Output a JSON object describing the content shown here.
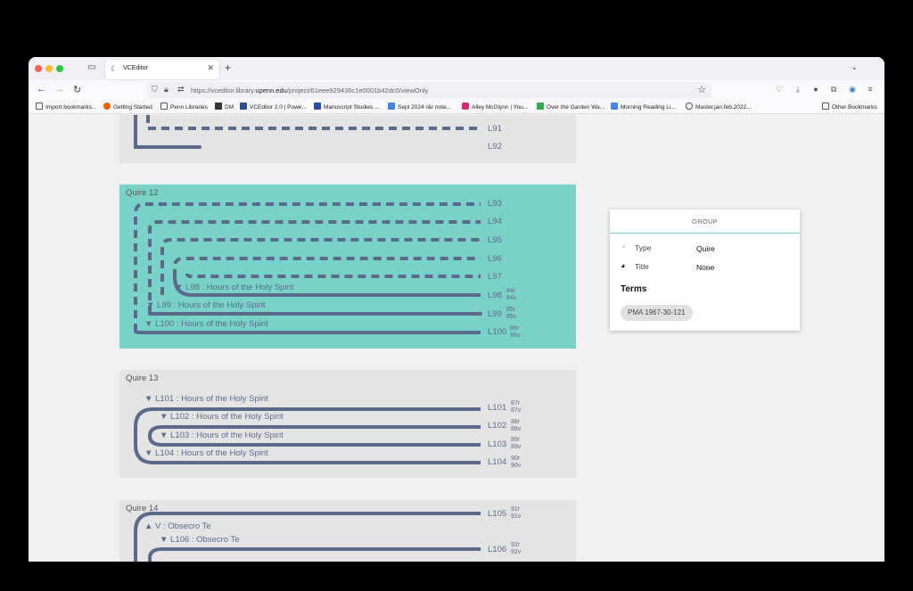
{
  "browser": {
    "tab_title": "VCEditor",
    "url_prefix": "https://vceditor.library.",
    "url_domain": "upenn.edu",
    "url_path": "/project/61eee929435c1e0001b42dc0/viewOnly"
  },
  "bookmarks": [
    "Import bookmarks...",
    "Getting Started",
    "Penn Libraries",
    "DM",
    "VCEditor 2.0 | Powe...",
    "Manuscript Studies ...",
    "Sept 2024 r&r note...",
    "Alley McGlynn | You...",
    "Over the Garden Wa...",
    "Morning Reading Li...",
    "Master.jan.feb.2022...",
    "Other Bookmarks"
  ],
  "quires": {
    "q11": {
      "leaves": [
        {
          "label": "L91"
        },
        {
          "label": "L92"
        }
      ]
    },
    "q12": {
      "title": "Quire 12",
      "color": "#78d2c8",
      "leaves": [
        {
          "label": "L93"
        },
        {
          "label": "L94"
        },
        {
          "label": "L95"
        },
        {
          "label": "L96"
        },
        {
          "label": "L97"
        },
        {
          "label": "L98",
          "folio_r": "84r",
          "folio_v": "84v",
          "term": "▼ L98 : Hours of the Holy Spirit"
        },
        {
          "label": "L99",
          "folio_r": "85r",
          "folio_v": "85v",
          "term": "▼ L99 : Hours of the Holy Spirit"
        },
        {
          "label": "L100",
          "folio_r": "86r",
          "folio_v": "86v",
          "term": "▼ L100 : Hours of the Holy Spirit"
        }
      ]
    },
    "q13": {
      "title": "Quire 13",
      "leaves": [
        {
          "label": "L101",
          "folio_r": "87r",
          "folio_v": "87v",
          "term": "▼ L101 : Hours of the Holy Spirit"
        },
        {
          "label": "L102",
          "folio_r": "88r",
          "folio_v": "88v",
          "term": "▼ L102 : Hours of the Holy Spirit"
        },
        {
          "label": "L103",
          "folio_r": "89r",
          "folio_v": "89v",
          "term": "▼ L103 : Hours of the Holy Spirit"
        },
        {
          "label": "L104",
          "folio_r": "90r",
          "folio_v": "90v",
          "term": "▼ L104 : Hours of the Holy Spirit"
        }
      ]
    },
    "q14": {
      "title": "Quire 14",
      "leaves": [
        {
          "label": "L105",
          "folio_r": "91r",
          "folio_v": "91v"
        },
        {
          "label": "L106",
          "folio_r": "92r",
          "folio_v": "92v"
        }
      ],
      "terms": [
        "▲ V : Obsecro Te",
        "▼ L106 : Obsecro Te"
      ]
    }
  },
  "panel": {
    "header": "GROUP",
    "type_label": "Type",
    "type_value": "Quire",
    "title_label": "Title",
    "title_value": "None",
    "terms_heading": "Terms",
    "term_chip": "PMA 1967-30-121"
  },
  "colors": {
    "line": "#5b6a8c",
    "selected_quire_bg": "#78d2c8",
    "quire_bg": "#e4e4e4"
  }
}
